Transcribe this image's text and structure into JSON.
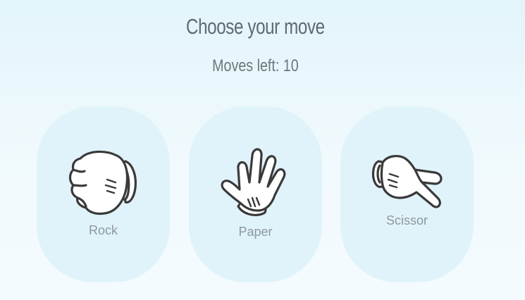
{
  "game": {
    "title": "Choose your move",
    "moves_left_label": "Moves left:",
    "moves_left_value": 10
  },
  "choices": [
    {
      "id": "rock",
      "label": "Rock",
      "icon": "rock-hand-icon"
    },
    {
      "id": "paper",
      "label": "Paper",
      "icon": "paper-hand-icon"
    },
    {
      "id": "scissor",
      "label": "Scissor",
      "icon": "scissor-hand-icon"
    }
  ],
  "colors": {
    "card_background": "#e0f3fa",
    "glove_fill": "#ffffff",
    "glove_outline": "#3a3a3a",
    "title_text": "#5e6a70",
    "label_text": "#8e989c"
  }
}
